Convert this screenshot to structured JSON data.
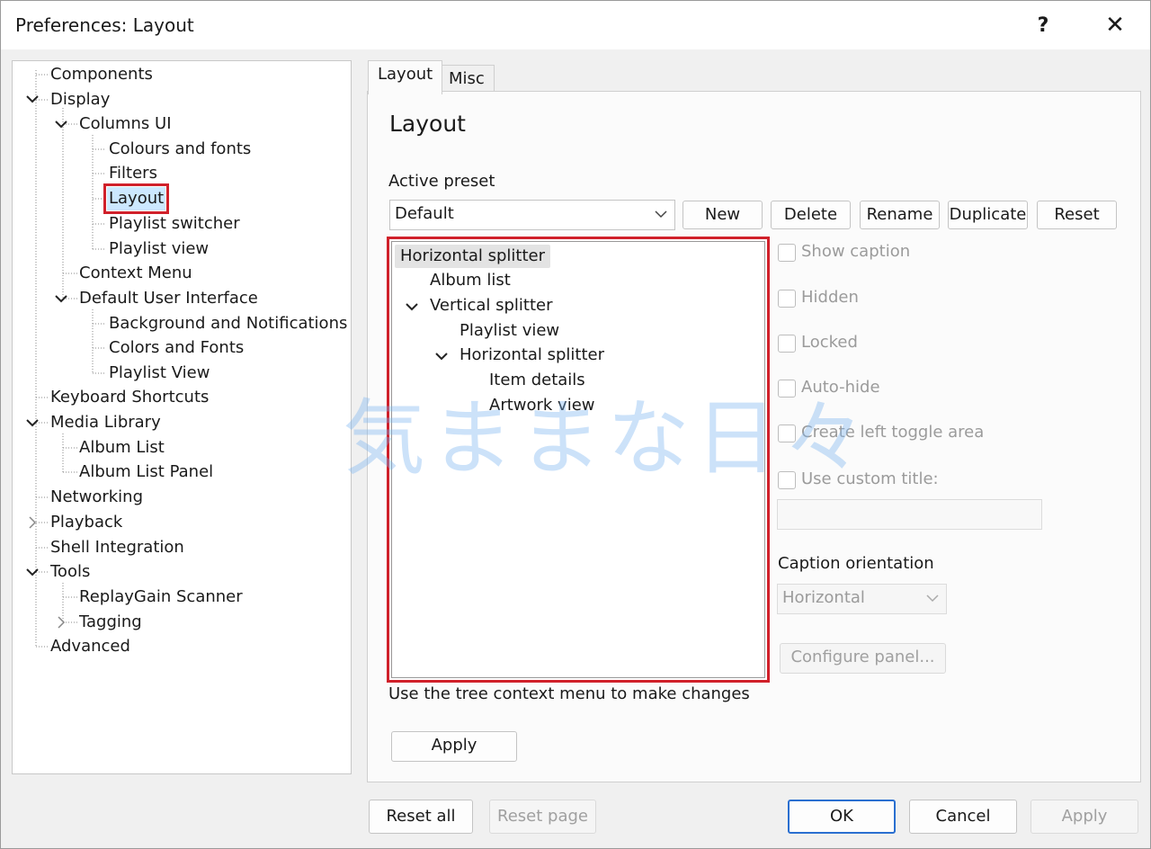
{
  "window": {
    "title": "Preferences: Layout",
    "help_glyph": "?",
    "close_glyph": "✕"
  },
  "nav": {
    "items": [
      {
        "label": "Components"
      },
      {
        "label": "Display"
      },
      {
        "label": "Columns UI"
      },
      {
        "label": "Colours and fonts"
      },
      {
        "label": "Filters"
      },
      {
        "label": "Layout"
      },
      {
        "label": "Playlist switcher"
      },
      {
        "label": "Playlist view"
      },
      {
        "label": "Context Menu"
      },
      {
        "label": "Default User Interface"
      },
      {
        "label": "Background and Notifications"
      },
      {
        "label": "Colors and Fonts"
      },
      {
        "label": "Playlist View"
      },
      {
        "label": "Keyboard Shortcuts"
      },
      {
        "label": "Media Library"
      },
      {
        "label": "Album List"
      },
      {
        "label": "Album List Panel"
      },
      {
        "label": "Networking"
      },
      {
        "label": "Playback"
      },
      {
        "label": "Shell Integration"
      },
      {
        "label": "Tools"
      },
      {
        "label": "ReplayGain Scanner"
      },
      {
        "label": "Tagging"
      },
      {
        "label": "Advanced"
      }
    ],
    "selected": "Layout"
  },
  "tabs": [
    {
      "label": "Layout"
    },
    {
      "label": "Misc"
    }
  ],
  "layout_page": {
    "heading": "Layout",
    "active_preset_label": "Active preset",
    "preset_value": "Default",
    "buttons": {
      "new": "New",
      "delete": "Delete",
      "rename": "Rename",
      "duplicate": "Duplicate",
      "reset": "Reset"
    },
    "tree": [
      {
        "label": "Horizontal splitter"
      },
      {
        "label": "Album list"
      },
      {
        "label": "Vertical splitter"
      },
      {
        "label": "Playlist view"
      },
      {
        "label": "Horizontal splitter"
      },
      {
        "label": "Item details"
      },
      {
        "label": "Artwork view"
      }
    ],
    "options": {
      "show_caption": "Show caption",
      "hidden": "Hidden",
      "locked": "Locked",
      "auto_hide": "Auto-hide",
      "create_left_toggle": "Create left toggle area",
      "use_custom_title": "Use custom title:"
    },
    "custom_title_value": "",
    "caption_orientation_label": "Caption orientation",
    "caption_orientation_value": "Horizontal",
    "configure_panel": "Configure panel...",
    "hint": "Use the tree context menu to make changes",
    "apply": "Apply"
  },
  "footer": {
    "reset_all": "Reset all",
    "reset_page": "Reset page",
    "ok": "OK",
    "cancel": "Cancel",
    "apply": "Apply"
  },
  "watermark": "気ままな日々",
  "colors": {
    "highlight_red": "#d0202a",
    "selection_blue": "#cce8ff",
    "ok_border": "#2a6fd0"
  }
}
